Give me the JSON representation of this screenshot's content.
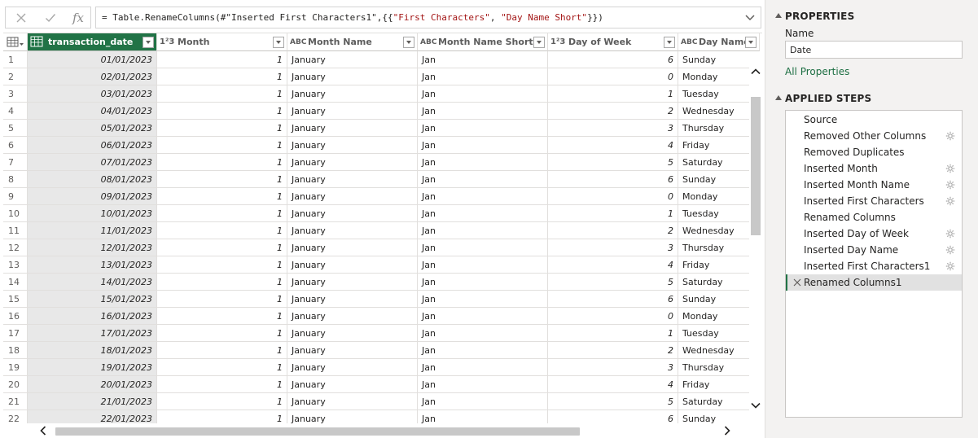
{
  "formula": {
    "prefix": "= Table.RenameColumns(#\"Inserted First Characters1\",{{",
    "str1": "\"First Characters\"",
    "sep": ", ",
    "str2": "\"Day Name Short\"",
    "suffix": "}})",
    "fx_label": "fx"
  },
  "columns": [
    {
      "name": "transaction_date",
      "type_icon": "date-table",
      "selected": true
    },
    {
      "name": "Month",
      "type_icon": "1²3"
    },
    {
      "name": "Month Name",
      "type_icon": "ABC"
    },
    {
      "name": "Month Name Short",
      "type_icon": "ABC"
    },
    {
      "name": "Day of Week",
      "type_icon": "1²3"
    },
    {
      "name": "Day Name",
      "type_icon": "ABC"
    }
  ],
  "rows": [
    [
      "1",
      "01/01/2023",
      "1",
      "January",
      "Jan",
      "6",
      "Sunday"
    ],
    [
      "2",
      "02/01/2023",
      "1",
      "January",
      "Jan",
      "0",
      "Monday"
    ],
    [
      "3",
      "03/01/2023",
      "1",
      "January",
      "Jan",
      "1",
      "Tuesday"
    ],
    [
      "4",
      "04/01/2023",
      "1",
      "January",
      "Jan",
      "2",
      "Wednesday"
    ],
    [
      "5",
      "05/01/2023",
      "1",
      "January",
      "Jan",
      "3",
      "Thursday"
    ],
    [
      "6",
      "06/01/2023",
      "1",
      "January",
      "Jan",
      "4",
      "Friday"
    ],
    [
      "7",
      "07/01/2023",
      "1",
      "January",
      "Jan",
      "5",
      "Saturday"
    ],
    [
      "8",
      "08/01/2023",
      "1",
      "January",
      "Jan",
      "6",
      "Sunday"
    ],
    [
      "9",
      "09/01/2023",
      "1",
      "January",
      "Jan",
      "0",
      "Monday"
    ],
    [
      "10",
      "10/01/2023",
      "1",
      "January",
      "Jan",
      "1",
      "Tuesday"
    ],
    [
      "11",
      "11/01/2023",
      "1",
      "January",
      "Jan",
      "2",
      "Wednesday"
    ],
    [
      "12",
      "12/01/2023",
      "1",
      "January",
      "Jan",
      "3",
      "Thursday"
    ],
    [
      "13",
      "13/01/2023",
      "1",
      "January",
      "Jan",
      "4",
      "Friday"
    ],
    [
      "14",
      "14/01/2023",
      "1",
      "January",
      "Jan",
      "5",
      "Saturday"
    ],
    [
      "15",
      "15/01/2023",
      "1",
      "January",
      "Jan",
      "6",
      "Sunday"
    ],
    [
      "16",
      "16/01/2023",
      "1",
      "January",
      "Jan",
      "0",
      "Monday"
    ],
    [
      "17",
      "17/01/2023",
      "1",
      "January",
      "Jan",
      "1",
      "Tuesday"
    ],
    [
      "18",
      "18/01/2023",
      "1",
      "January",
      "Jan",
      "2",
      "Wednesday"
    ],
    [
      "19",
      "19/01/2023",
      "1",
      "January",
      "Jan",
      "3",
      "Thursday"
    ],
    [
      "20",
      "20/01/2023",
      "1",
      "January",
      "Jan",
      "4",
      "Friday"
    ],
    [
      "21",
      "21/01/2023",
      "1",
      "January",
      "Jan",
      "5",
      "Saturday"
    ],
    [
      "22",
      "22/01/2023",
      "1",
      "January",
      "Jan",
      "6",
      "Sunday"
    ]
  ],
  "properties": {
    "title": "PROPERTIES",
    "name_label": "Name",
    "name_value": "Date",
    "all_properties": "All Properties"
  },
  "applied_steps": {
    "title": "APPLIED STEPS",
    "steps": [
      {
        "label": "Source",
        "gear": false
      },
      {
        "label": "Removed Other Columns",
        "gear": true
      },
      {
        "label": "Removed Duplicates",
        "gear": false
      },
      {
        "label": "Inserted Month",
        "gear": true
      },
      {
        "label": "Inserted Month Name",
        "gear": true
      },
      {
        "label": "Inserted First Characters",
        "gear": true
      },
      {
        "label": "Renamed Columns",
        "gear": false
      },
      {
        "label": "Inserted Day of Week",
        "gear": true
      },
      {
        "label": "Inserted Day Name",
        "gear": true
      },
      {
        "label": "Inserted First Characters1",
        "gear": true
      },
      {
        "label": "Renamed Columns1",
        "gear": false,
        "active": true
      }
    ]
  },
  "colors": {
    "accent": "#217346",
    "link": "#1c6e42",
    "selected_column_bg": "#e8e8e8"
  }
}
